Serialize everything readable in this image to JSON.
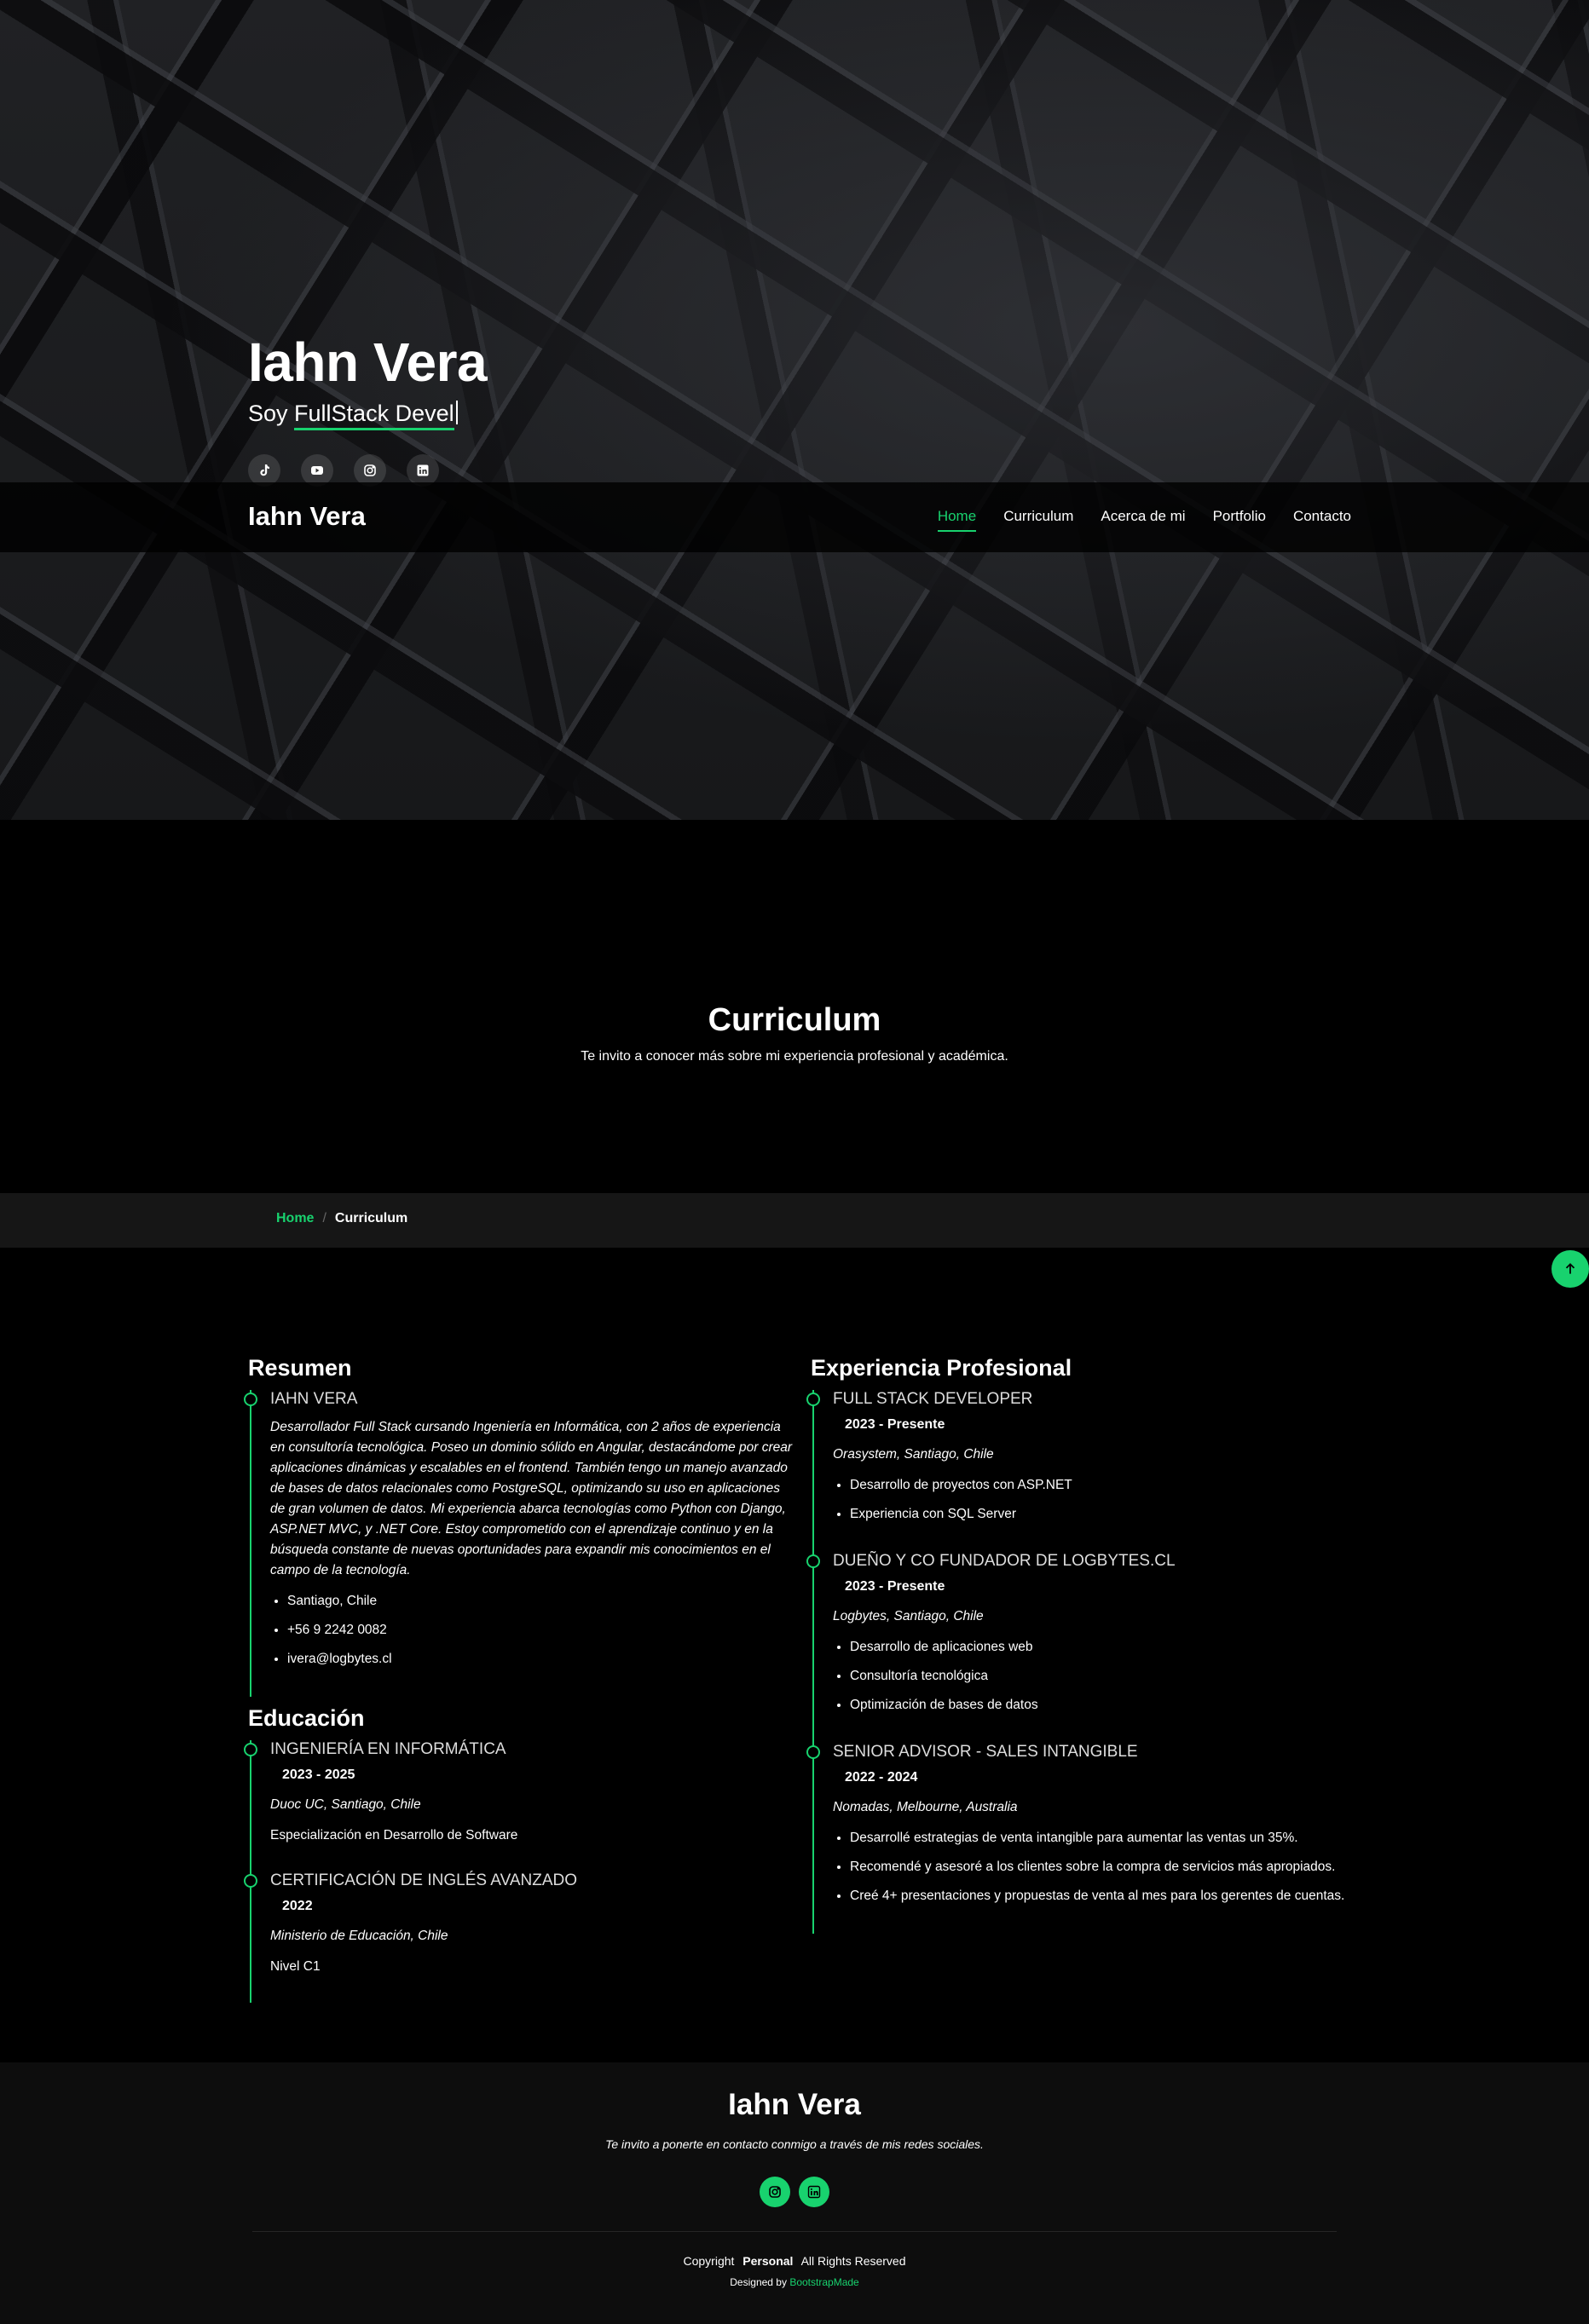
{
  "hero": {
    "title": "Iahn Vera",
    "subtitle_prefix": "Soy ",
    "subtitle_typed": "FullStack Devel",
    "social": [
      {
        "icon": "tiktok-icon"
      },
      {
        "icon": "youtube-icon"
      },
      {
        "icon": "instagram-icon"
      },
      {
        "icon": "linkedin-icon"
      }
    ]
  },
  "navbar": {
    "logo": "Iahn Vera",
    "links": [
      "Home",
      "Curriculum",
      "Acerca de mi",
      "Portfolio",
      "Contacto"
    ],
    "active": "Home"
  },
  "section": {
    "title": "Curriculum",
    "subtitle": "Te invito a conocer más sobre mi experiencia profesional y académica."
  },
  "breadcrumb": {
    "home": "Home",
    "separator": "/",
    "current": "Curriculum"
  },
  "resume": {
    "summary_title": "Resumen",
    "summary": {
      "name": "IAHN VERA",
      "description": "Desarrollador Full Stack cursando Ingeniería en Informática, con 2 años de experiencia en consultoría tecnológica. Poseo un dominio sólido en Angular, destacándome por crear aplicaciones dinámicas y escalables en el frontend. También tengo un manejo avanzado de bases de datos relacionales como PostgreSQL, optimizando su uso en aplicaciones de gran volumen de datos. Mi experiencia abarca tecnologías como Python con Django, ASP.NET MVC, y .NET Core. Estoy comprometido con el aprendizaje continuo y en la búsqueda constante de nuevas oportunidades para expandir mis conocimientos en el campo de la tecnología.",
      "contacts": [
        "Santiago, Chile",
        "+56 9 2242 0082",
        "ivera@logbytes.cl"
      ]
    },
    "education_title": "Educación",
    "education": [
      {
        "title": "INGENIERÍA EN INFORMÁTICA",
        "years": "2023 - 2025",
        "place": "Duoc UC, Santiago, Chile",
        "detail": "Especialización en Desarrollo de Software"
      },
      {
        "title": "CERTIFICACIÓN DE INGLÉS AVANZADO",
        "years": "2022",
        "place": "Ministerio de Educación, Chile",
        "detail": "Nivel C1"
      }
    ],
    "experience_title": "Experiencia Profesional",
    "experience": [
      {
        "title": "FULL STACK DEVELOPER",
        "years": "2023 - Presente",
        "place": "Orasystem, Santiago, Chile",
        "bullets": [
          "Desarrollo de proyectos con ASP.NET",
          "Experiencia con SQL Server"
        ]
      },
      {
        "title": "DUEÑO Y CO FUNDADOR DE LOGBYTES.CL",
        "years": "2023 - Presente",
        "place": "Logbytes, Santiago, Chile",
        "bullets": [
          "Desarrollo de aplicaciones web",
          "Consultoría tecnológica",
          "Optimización de bases de datos"
        ]
      },
      {
        "title": "SENIOR ADVISOR - SALES INTANGIBLE",
        "years": "2022 - 2024",
        "place": "Nomadas, Melbourne, Australia",
        "bullets": [
          "Desarrollé estrategias de venta intangible para aumentar las ventas un 35%.",
          "Recomendé y asesoré a los clientes sobre la compra de servicios más apropiados.",
          "Creé 4+ presentaciones y propuestas de venta al mes para los gerentes de cuentas."
        ]
      }
    ]
  },
  "footer": {
    "title": "Iahn Vera",
    "tagline": "Te invito a ponerte en contacto conmigo a través de mis redes sociales.",
    "social": [
      {
        "icon": "instagram-icon"
      },
      {
        "icon": "linkedin-icon"
      }
    ],
    "copyright_prefix": "Copyright",
    "copyright_brand": "Personal",
    "copyright_suffix": "All Rights Reserved",
    "designed_by": "Designed by",
    "designer": "BootstrapMade"
  },
  "colors": {
    "accent": "#18d26e",
    "background": "#000000",
    "footer_bg": "#0d0d0d",
    "breadcrumb_bg": "#161616"
  }
}
